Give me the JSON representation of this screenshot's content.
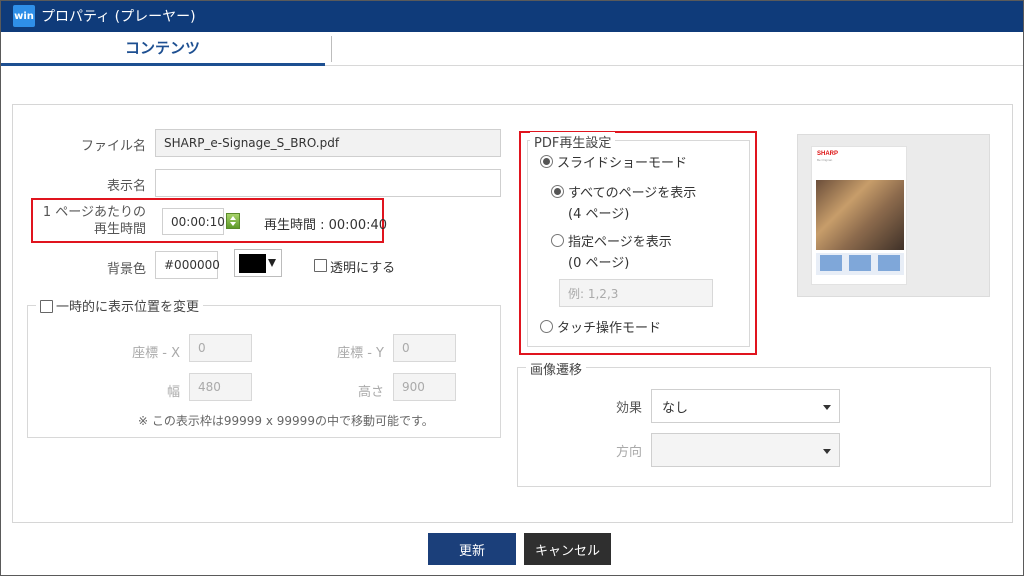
{
  "window": {
    "title": "プロパティ (プレーヤー)",
    "logo_text": "win",
    "accent_color": "#0f3b7a"
  },
  "tabs": [
    {
      "label": "コンテンツ",
      "active": true
    }
  ],
  "file": {
    "label": "ファイル名",
    "value": "SHARP_e-Signage_S_BRO.pdf"
  },
  "display_name": {
    "label": "表示名",
    "value": ""
  },
  "page_time": {
    "label_line1": "1 ページあたりの",
    "label_line2": "再生時間",
    "value": "00:00:10",
    "total_text": "再生時間 : 00:00:40"
  },
  "bg_color": {
    "label": "背景色",
    "value": "#000000",
    "transparent_label": "透明にする"
  },
  "position": {
    "legend": "一時的に表示位置を変更",
    "x_label": "座標 - X",
    "x_value": "0",
    "y_label": "座標 - Y",
    "y_value": "0",
    "w_label": "幅",
    "w_value": "480",
    "h_label": "高さ",
    "h_value": "900",
    "note": "※ この表示枠は99999 x 99999の中で移動可能です。"
  },
  "pdf": {
    "legend": "PDF再生設定",
    "slideshow_label": "スライドショーモード",
    "all_pages_label": "すべてのページを表示",
    "all_pages_count": "(4 ページ)",
    "specified_label": "指定ページを表示",
    "specified_count": "(0 ページ)",
    "pages_placeholder": "例: 1,2,3",
    "touch_label": "タッチ操作モード"
  },
  "transition": {
    "legend": "画像遷移",
    "effect_label": "効果",
    "effect_value": "なし",
    "direction_label": "方向",
    "direction_value": ""
  },
  "thumbnail": {
    "logo": "SHARP",
    "sub": "Be Original."
  },
  "buttons": {
    "update": "更新",
    "cancel": "キャンセル"
  },
  "colors": {
    "highlight": "#e0141e",
    "update_button": "#1b3f7a",
    "cancel_button": "#2f2f2f"
  }
}
